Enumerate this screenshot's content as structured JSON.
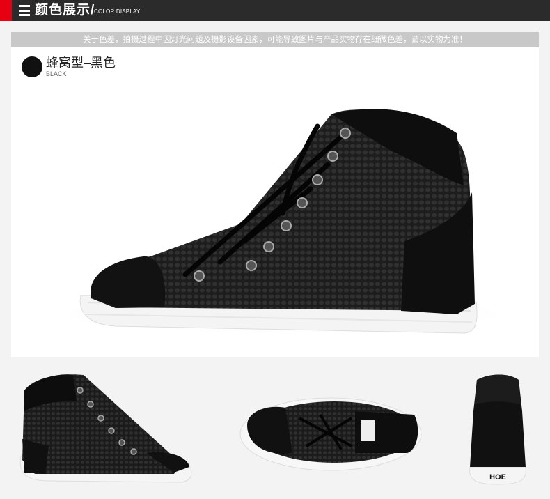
{
  "header": {
    "title_cn": "颜色展示/",
    "title_en": "COLOR DISPLAY",
    "accent_color": "#e60012",
    "bar_color": "#2b2b2b"
  },
  "notice": "关于色差，拍摄过程中因灯光问题及摄影设备因素，可能导致图片与产品实物存在细微色差，请以实物为准！",
  "color_option": {
    "name_cn": "蜂窝型–黑色",
    "name_en": "BLACK",
    "swatch_color": "#111111"
  },
  "images": {
    "main": "black-hightop-sneaker-side",
    "thumbnails": [
      "sneaker-front-angle",
      "sneaker-top-view",
      "sneaker-back-view"
    ]
  },
  "heel_brand": "HOE"
}
